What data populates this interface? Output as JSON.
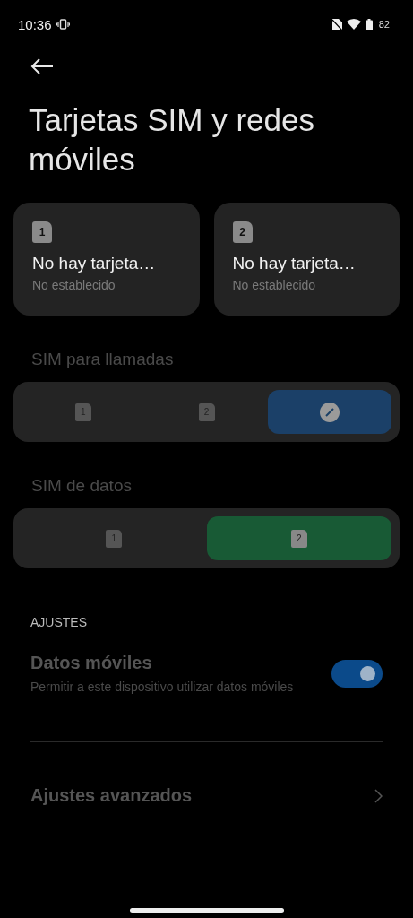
{
  "status_bar": {
    "time": "10:36",
    "battery": "82"
  },
  "title": "Tarjetas SIM y redes móviles",
  "sim_cards": [
    {
      "number": "1",
      "name": "No hay tarjeta…",
      "status": "No establecido"
    },
    {
      "number": "2",
      "name": "No hay tarjeta…",
      "status": "No establecido"
    }
  ],
  "selectors": [
    {
      "label": "SIM para llamadas",
      "disabled": true,
      "options": [
        {
          "kind": "sim",
          "number": "1",
          "selected": false
        },
        {
          "kind": "sim",
          "number": "2",
          "selected": false
        },
        {
          "kind": "ask",
          "selected": true
        }
      ]
    },
    {
      "label": "SIM de datos",
      "disabled": true,
      "options": [
        {
          "kind": "sim",
          "number": "1",
          "selected": false
        },
        {
          "kind": "sim",
          "number": "2",
          "selected": true
        }
      ]
    }
  ],
  "settings": {
    "heading": "AJUSTES",
    "items": [
      {
        "kind": "toggle",
        "title": "Datos móviles",
        "subtitle": "Permitir a este dispositivo utilizar datos móviles",
        "on": true,
        "disabled": true
      },
      {
        "kind": "link",
        "title": "Ajustes avanzados",
        "disabled": true
      }
    ]
  }
}
